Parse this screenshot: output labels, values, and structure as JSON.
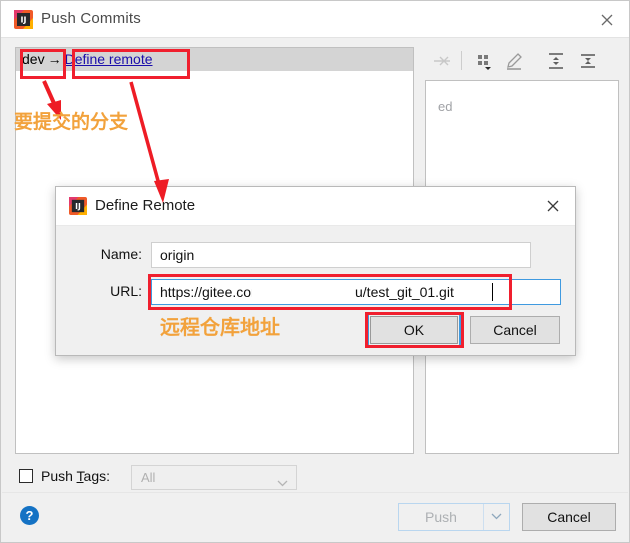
{
  "window": {
    "title": "Push Commits",
    "icon": "intellij-idea-icon",
    "close_icon": "close-icon"
  },
  "commit_list": {
    "rows": [
      {
        "branch": "dev",
        "arrow": "→",
        "remote_link": "Define remote"
      }
    ]
  },
  "detail_toolbar": {
    "buttons": [
      {
        "name": "collapse-to-selection-icon",
        "label": "Collapse to selection"
      },
      {
        "name": "group-by-icon",
        "label": "Group by"
      },
      {
        "name": "edit-icon",
        "label": "Edit"
      },
      {
        "name": "expand-all-icon",
        "label": "Expand all"
      },
      {
        "name": "collapse-all-icon",
        "label": "Collapse all"
      }
    ]
  },
  "detail_panel": {
    "empty_text": "ed"
  },
  "push_tags": {
    "checkbox_checked": false,
    "label_prefix": "Push ",
    "label_mnemonic": "T",
    "label_suffix": "ags:",
    "combo_value": "All",
    "combo_enabled": false
  },
  "footer": {
    "help_label": "?",
    "push_label": "Push",
    "push_enabled": false,
    "push_dropdown_icon": "chevron-down-icon",
    "cancel_label": "Cancel"
  },
  "define_remote_dialog": {
    "title": "Define Remote",
    "icon": "intellij-idea-icon",
    "close_icon": "close-icon",
    "name_label": "Name:",
    "name_value": "origin",
    "url_label": "URL:",
    "url_value_prefix": "https://gitee.com/z",
    "url_value_suffix": "u/test_git_01.git",
    "ok_label": "OK",
    "cancel_label": "Cancel"
  },
  "annotations": {
    "branch_note": "要提交的分支",
    "url_note": "远程仓库地址",
    "box_color": "#f01f2e",
    "text_color": "#f2a23c",
    "arrow_color": "#ee1c25"
  }
}
